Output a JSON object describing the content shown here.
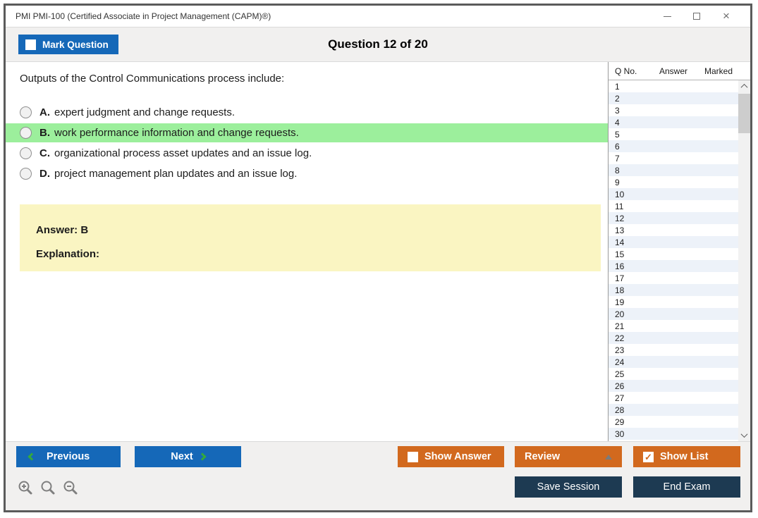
{
  "window": {
    "title": "PMI PMI-100 (Certified Associate in Project Management (CAPM)®)",
    "controls": {
      "minimize": "minimize",
      "maximize": "maximize",
      "close": "×"
    }
  },
  "header": {
    "mark_question_label": "Mark Question",
    "mark_question_checked": false,
    "question_counter": "Question 12 of 20"
  },
  "question": {
    "text": "Outputs of the Control Communications process include:",
    "options": [
      {
        "letter": "A.",
        "text": "expert judgment and change requests.",
        "highlighted": false
      },
      {
        "letter": "B.",
        "text": "work performance information and change requests.",
        "highlighted": true
      },
      {
        "letter": "C.",
        "text": "organizational process asset updates and an issue log.",
        "highlighted": false
      },
      {
        "letter": "D.",
        "text": "project management plan updates and an issue log.",
        "highlighted": false
      }
    ],
    "answer_label": "Answer: B",
    "explanation_label": "Explanation:"
  },
  "question_list": {
    "columns": [
      "Q No.",
      "Answer",
      "Marked"
    ],
    "rows": [
      {
        "q": "1",
        "answer": "",
        "marked": ""
      },
      {
        "q": "2",
        "answer": "",
        "marked": ""
      },
      {
        "q": "3",
        "answer": "",
        "marked": ""
      },
      {
        "q": "4",
        "answer": "",
        "marked": ""
      },
      {
        "q": "5",
        "answer": "",
        "marked": ""
      },
      {
        "q": "6",
        "answer": "",
        "marked": ""
      },
      {
        "q": "7",
        "answer": "",
        "marked": ""
      },
      {
        "q": "8",
        "answer": "",
        "marked": ""
      },
      {
        "q": "9",
        "answer": "",
        "marked": ""
      },
      {
        "q": "10",
        "answer": "",
        "marked": ""
      },
      {
        "q": "11",
        "answer": "",
        "marked": ""
      },
      {
        "q": "12",
        "answer": "",
        "marked": ""
      },
      {
        "q": "13",
        "answer": "",
        "marked": ""
      },
      {
        "q": "14",
        "answer": "",
        "marked": ""
      },
      {
        "q": "15",
        "answer": "",
        "marked": ""
      },
      {
        "q": "16",
        "answer": "",
        "marked": ""
      },
      {
        "q": "17",
        "answer": "",
        "marked": ""
      },
      {
        "q": "18",
        "answer": "",
        "marked": ""
      },
      {
        "q": "19",
        "answer": "",
        "marked": ""
      },
      {
        "q": "20",
        "answer": "",
        "marked": ""
      },
      {
        "q": "21",
        "answer": "",
        "marked": ""
      },
      {
        "q": "22",
        "answer": "",
        "marked": ""
      },
      {
        "q": "23",
        "answer": "",
        "marked": ""
      },
      {
        "q": "24",
        "answer": "",
        "marked": ""
      },
      {
        "q": "25",
        "answer": "",
        "marked": ""
      },
      {
        "q": "26",
        "answer": "",
        "marked": ""
      },
      {
        "q": "27",
        "answer": "",
        "marked": ""
      },
      {
        "q": "28",
        "answer": "",
        "marked": ""
      },
      {
        "q": "29",
        "answer": "",
        "marked": ""
      },
      {
        "q": "30",
        "answer": "",
        "marked": ""
      }
    ]
  },
  "footer": {
    "previous_label": "Previous",
    "next_label": "Next",
    "show_answer_label": "Show Answer",
    "show_answer_checked": false,
    "review_label": "Review",
    "show_list_label": "Show List",
    "show_list_checked": true,
    "save_session_label": "Save Session",
    "end_exam_label": "End Exam",
    "zoom_tools": [
      "zoom-in",
      "zoom-reset",
      "zoom-out"
    ]
  },
  "colors": {
    "accent_blue": "#1568b8",
    "accent_orange": "#d2691e",
    "accent_navy": "#1d3a52",
    "highlight_green": "#9cef9c",
    "answer_yellow": "#faf5c2",
    "row_alt_blue": "#edf2f9",
    "chevron_green": "#35a93c"
  }
}
